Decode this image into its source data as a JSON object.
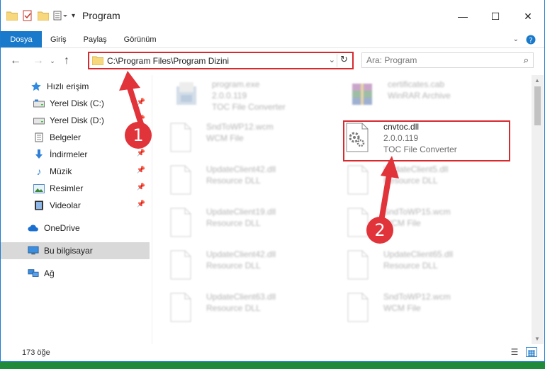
{
  "window": {
    "title": "Program",
    "controls": {
      "minimize": "—",
      "maximize": "☐",
      "close": "✕"
    }
  },
  "ribbon": {
    "tabs": [
      "Dosya",
      "Giriş",
      "Paylaş",
      "Görünüm"
    ]
  },
  "address": {
    "path": "C:\\Program Files\\Program Dizini",
    "search_placeholder": "Ara: Program"
  },
  "sidebar": {
    "items": [
      {
        "label": "Hızlı erişim",
        "icon": "star-icon",
        "pinned": false
      },
      {
        "label": "Yerel Disk (C:)",
        "icon": "drive-icon",
        "pinned": true
      },
      {
        "label": "Yerel Disk (D:)",
        "icon": "drive-icon",
        "pinned": true
      },
      {
        "label": "Belgeler",
        "icon": "documents-icon",
        "pinned": true
      },
      {
        "label": "İndirmeler",
        "icon": "download-icon",
        "pinned": true
      },
      {
        "label": "Müzik",
        "icon": "music-icon",
        "pinned": true
      },
      {
        "label": "Resimler",
        "icon": "pictures-icon",
        "pinned": true
      },
      {
        "label": "Videolar",
        "icon": "videos-icon",
        "pinned": true
      },
      {
        "label": "OneDrive",
        "icon": "cloud-icon",
        "pinned": false
      },
      {
        "label": "Bu bilgisayar",
        "icon": "computer-icon",
        "pinned": false
      },
      {
        "label": "Ağ",
        "icon": "network-icon",
        "pinned": false
      }
    ]
  },
  "files": [
    {
      "name": "program.exe",
      "line1": "2.0.0.119",
      "line2": "TOC File Converter",
      "icon": "exe-icon"
    },
    {
      "name": "certificates.cab",
      "line1": "WinRAR Archive",
      "line2": "",
      "icon": "archive-icon"
    },
    {
      "name": "SndToWP12.wcm",
      "line1": "WCM File",
      "line2": "",
      "icon": "file-icon"
    },
    {
      "name": "cnvtoc.dll",
      "line1": "2.0.0.119",
      "line2": "TOC File Converter",
      "icon": "dll-icon"
    },
    {
      "name": "UpdateClient42.dll",
      "line1": "Resource DLL",
      "line2": "",
      "icon": "file-icon"
    },
    {
      "name": "UpdateClient5.dll",
      "line1": "Resource DLL",
      "line2": "",
      "icon": "file-icon"
    },
    {
      "name": "UpdateClient19.dll",
      "line1": "Resource DLL",
      "line2": "",
      "icon": "file-icon"
    },
    {
      "name": "SndToWP15.wcm",
      "line1": "WCM File",
      "line2": "",
      "icon": "file-icon"
    },
    {
      "name": "UpdateClient42.dll",
      "line1": "Resource DLL",
      "line2": "",
      "icon": "file-icon"
    },
    {
      "name": "UpdateClient65.dll",
      "line1": "Resource DLL",
      "line2": "",
      "icon": "file-icon"
    },
    {
      "name": "UpdateClient63.dll",
      "line1": "Resource DLL",
      "line2": "",
      "icon": "file-icon"
    },
    {
      "name": "SndToWP12.wcm",
      "line1": "WCM File",
      "line2": "",
      "icon": "file-icon"
    }
  ],
  "status": {
    "count": "173 öğe"
  },
  "callouts": [
    "1",
    "2"
  ],
  "colors": {
    "accent": "#1979ca",
    "highlight": "#d8292f",
    "background": "#1f8a3a"
  }
}
